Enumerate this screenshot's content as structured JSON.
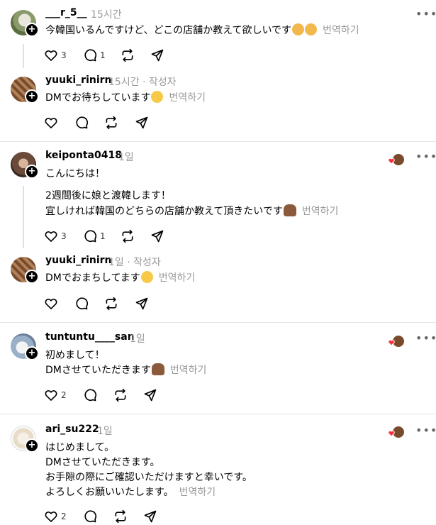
{
  "translate_label": "번역하기",
  "comments": [
    {
      "username": "___r_5__",
      "time": "15시간",
      "lines": [
        "今韓国いるんですけど、どこの店舗か教えて欲しいです"
      ],
      "likes": "3",
      "replies": "1"
    },
    {
      "username": "yuuki_rinirn",
      "time": "15시간 · 작성자",
      "lines": [
        "DMでお待ちしています"
      ]
    },
    {
      "username": "keiponta0418",
      "time": "1일",
      "lines": [
        "こんにちは！",
        "2週間後に娘と渡韓します！",
        "宜しければ韓国のどちらの店舗か教えて頂きたいです"
      ],
      "likes": "3",
      "replies": "1"
    },
    {
      "username": "yuuki_rinirn",
      "time": "1일 · 작성자",
      "lines": [
        "DMでおまちしてます"
      ]
    },
    {
      "username": "tuntuntu____san",
      "time": "1일",
      "lines": [
        "初めまして！",
        "DMさせていただきます"
      ],
      "likes": "2"
    },
    {
      "username": "ari_su222",
      "time": "1일",
      "lines": [
        "はじめまして。",
        "DMさせていただきます。",
        "お手隙の際にご確認いただけますと幸いです。",
        "よろしくお願いいたします。"
      ],
      "likes": "2"
    }
  ],
  "icons": [
    "heart-icon",
    "comment-icon",
    "repost-icon",
    "share-icon",
    "more-icon",
    "add-icon",
    "liked-by-author-icon"
  ],
  "colors": {
    "text": "#000000",
    "secondary": "#999999",
    "divider": "#e5e5e5"
  }
}
